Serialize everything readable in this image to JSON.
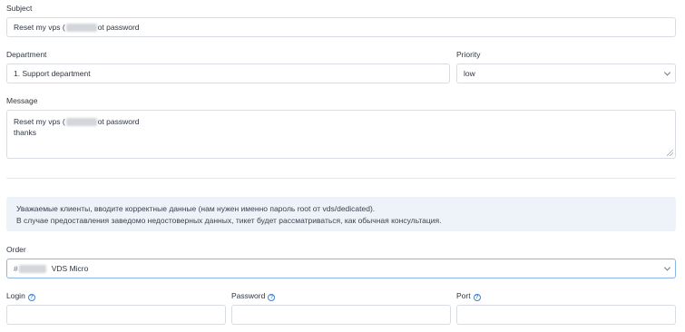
{
  "subject": {
    "label": "Subject",
    "value_before": "Reset my vps (",
    "value_after": "ot password"
  },
  "department": {
    "label": "Department",
    "value": "1. Support department"
  },
  "priority": {
    "label": "Priority",
    "value": "low"
  },
  "message": {
    "label": "Message",
    "line1_before": "Reset my vps (",
    "line1_after": "ot password",
    "line2": "thanks"
  },
  "notice": {
    "line1": "Уважаемые клиенты, вводите корректные данные (нам нужен именно пароль root от vds/dedicated).",
    "line2": "В случае предоставления заведомо недостоверных данных, тикет будет рассматриваться, как обычная консультация."
  },
  "order": {
    "label": "Order",
    "value_prefix": "#",
    "value_suffix": "VDS Micro"
  },
  "credentials": {
    "login_label": "Login",
    "password_label": "Password",
    "port_label": "Port",
    "help_glyph": "?"
  },
  "icons": {
    "dropdown": "chevron-down-icon",
    "help": "question-circle-icon"
  },
  "colors": {
    "accent": "#3b82d6",
    "notice_bg": "#eef3f9",
    "border": "#d8dde3"
  }
}
